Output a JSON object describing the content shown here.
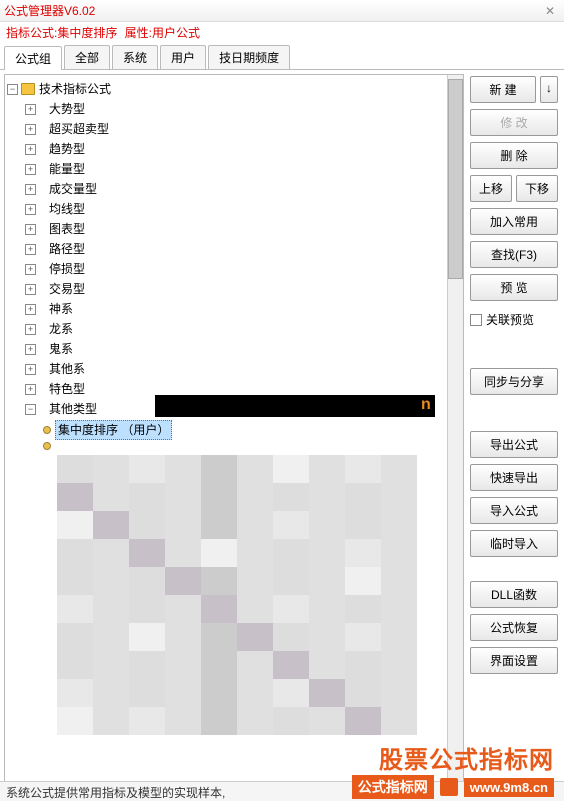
{
  "window": {
    "title": "公式管理器V6.02"
  },
  "info": {
    "label1": "指标公式:",
    "formula": "集中度排序",
    "label2": "属性:",
    "attr": "用户公式"
  },
  "tabs": [
    "公式组",
    "全部",
    "系统",
    "用户",
    "技日期频度"
  ],
  "tree": {
    "root": "技术指标公式",
    "groups": [
      "大势型",
      "超买超卖型",
      "趋势型",
      "能量型",
      "成交量型",
      "均线型",
      "图表型",
      "路径型",
      "停损型",
      "交易型",
      "神系",
      "龙系",
      "鬼系",
      "其他系",
      "特色型",
      "其他类型"
    ],
    "selected": "集中度排序  （用户）"
  },
  "buttons": {
    "new": "新  建",
    "modify": "修  改",
    "delete": "删  除",
    "moveup": "上移",
    "movedown": "下移",
    "addfav": "加入常用",
    "find": "查找(F3)",
    "preview": "预  览",
    "linkpreview": "关联预览",
    "sync": "同步与分享",
    "export": "导出公式",
    "fastexport": "快速导出",
    "import": "导入公式",
    "tempimport": "临时导入",
    "dll": "DLL函数",
    "restore": "公式恢复",
    "uisettings": "界面设置"
  },
  "status": "系统公式提供常用指标及模型的实现样本,",
  "watermark": {
    "line1": "股票公式指标网",
    "line2": "公式指标网",
    "url": "www.9m8.cn"
  },
  "orange_text": "n"
}
